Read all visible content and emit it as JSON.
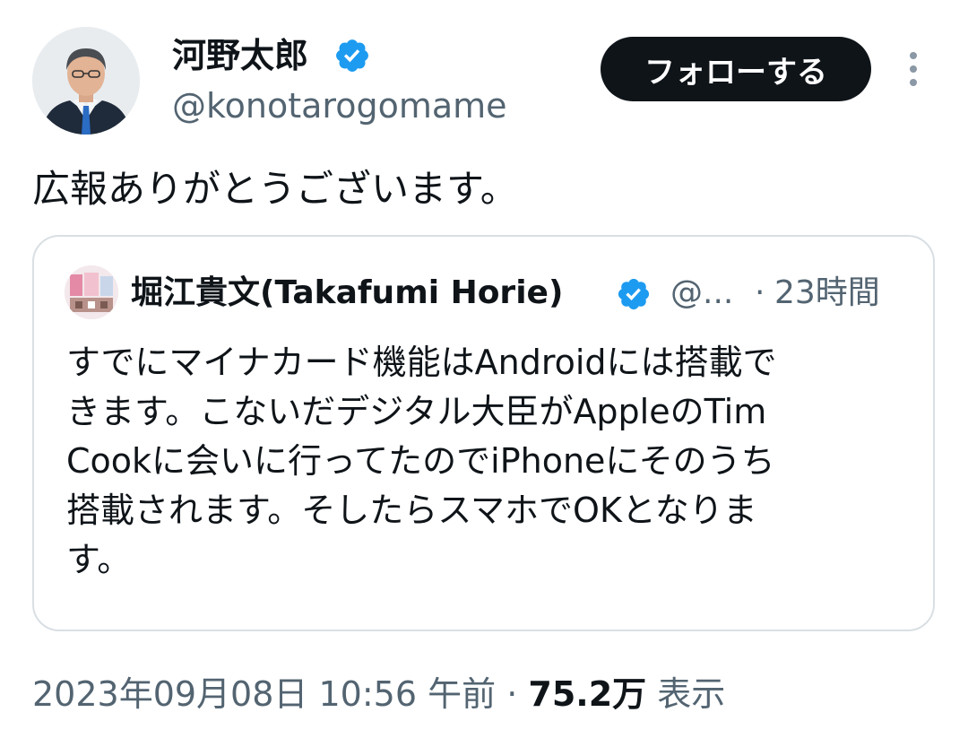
{
  "author": {
    "display_name": "河野太郎",
    "handle": "@konotarogomame",
    "verified_icon": "verified-badge-icon"
  },
  "actions": {
    "follow_label": "フォローする",
    "more_icon": "more-vertical-icon"
  },
  "tweet": {
    "text": "広報ありがとうございます。"
  },
  "quote": {
    "author_name": "堀江貴文(Takafumi Horie)",
    "handle": "@...",
    "separator": "·",
    "time": "23時間",
    "lines": [
      "すでにマイナカード機能はAndroidには搭載で",
      "きます。こないだデジタル大臣がAppleのTim",
      "Cookに会いに行ってたのでiPhoneにそのうち",
      "搭載されます。そしたらスマホでOKとなりま",
      "す。"
    ]
  },
  "meta": {
    "timestamp": "2023年09月08日 10:56 午前",
    "separator": "·",
    "views_count": "75.2万",
    "views_label": "表示"
  },
  "colors": {
    "text_primary": "#0f1419",
    "text_secondary": "#536471",
    "verified_blue": "#1d9bf0",
    "border": "#d9dfe3",
    "button_bg": "#0f1419"
  }
}
